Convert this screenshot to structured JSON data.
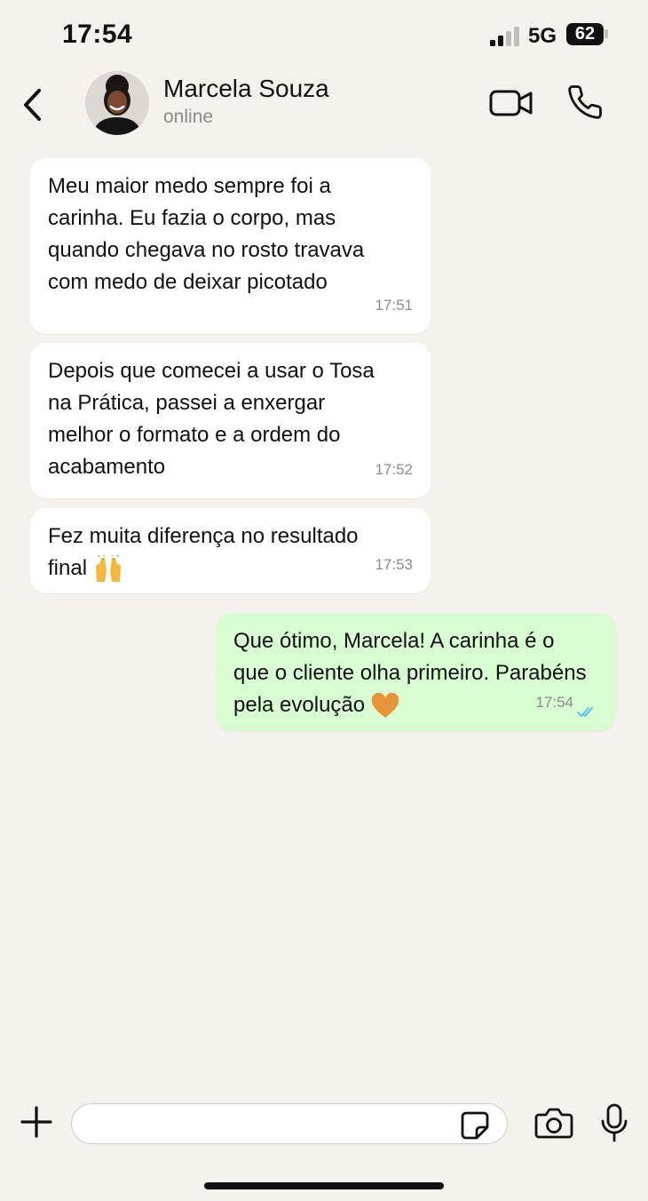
{
  "status_bar": {
    "time": "17:54",
    "network": "5G",
    "battery": "62"
  },
  "header": {
    "contact_name": "Marcela Souza",
    "contact_status": "online"
  },
  "messages": [
    {
      "direction": "incoming",
      "text": "Meu maior medo sempre foi a\ncarinha. Eu fazia o corpo, mas\nquando chegava no rosto travava\ncom medo de deixar picotado",
      "time": "17:51"
    },
    {
      "direction": "incoming",
      "text": "Depois que comecei a usar o Tosa\nna Prática, passei a enxergar\nmelhor o formato e a ordem do\nacabamento",
      "time": "17:52"
    },
    {
      "direction": "incoming",
      "text": "Fez muita diferença no resultado\nfinal",
      "emoji": "raising-hands",
      "time": "17:53"
    },
    {
      "direction": "outgoing",
      "text": "Que ótimo, Marcela! A carinha é o\nque o cliente olha primeiro. Parabéns\npela evolução",
      "emoji": "orange-heart",
      "time": "17:54",
      "status": "read"
    }
  ],
  "input": {
    "placeholder": ""
  },
  "colors": {
    "incoming_bubble": "#ffffff",
    "outgoing_bubble": "#d9fdd3",
    "read_ticks": "#53bdeb",
    "background": "#f5f2ee"
  },
  "icons": [
    "back-icon",
    "video-icon",
    "phone-icon",
    "plus-icon",
    "sticker-icon",
    "camera-icon",
    "mic-icon"
  ]
}
